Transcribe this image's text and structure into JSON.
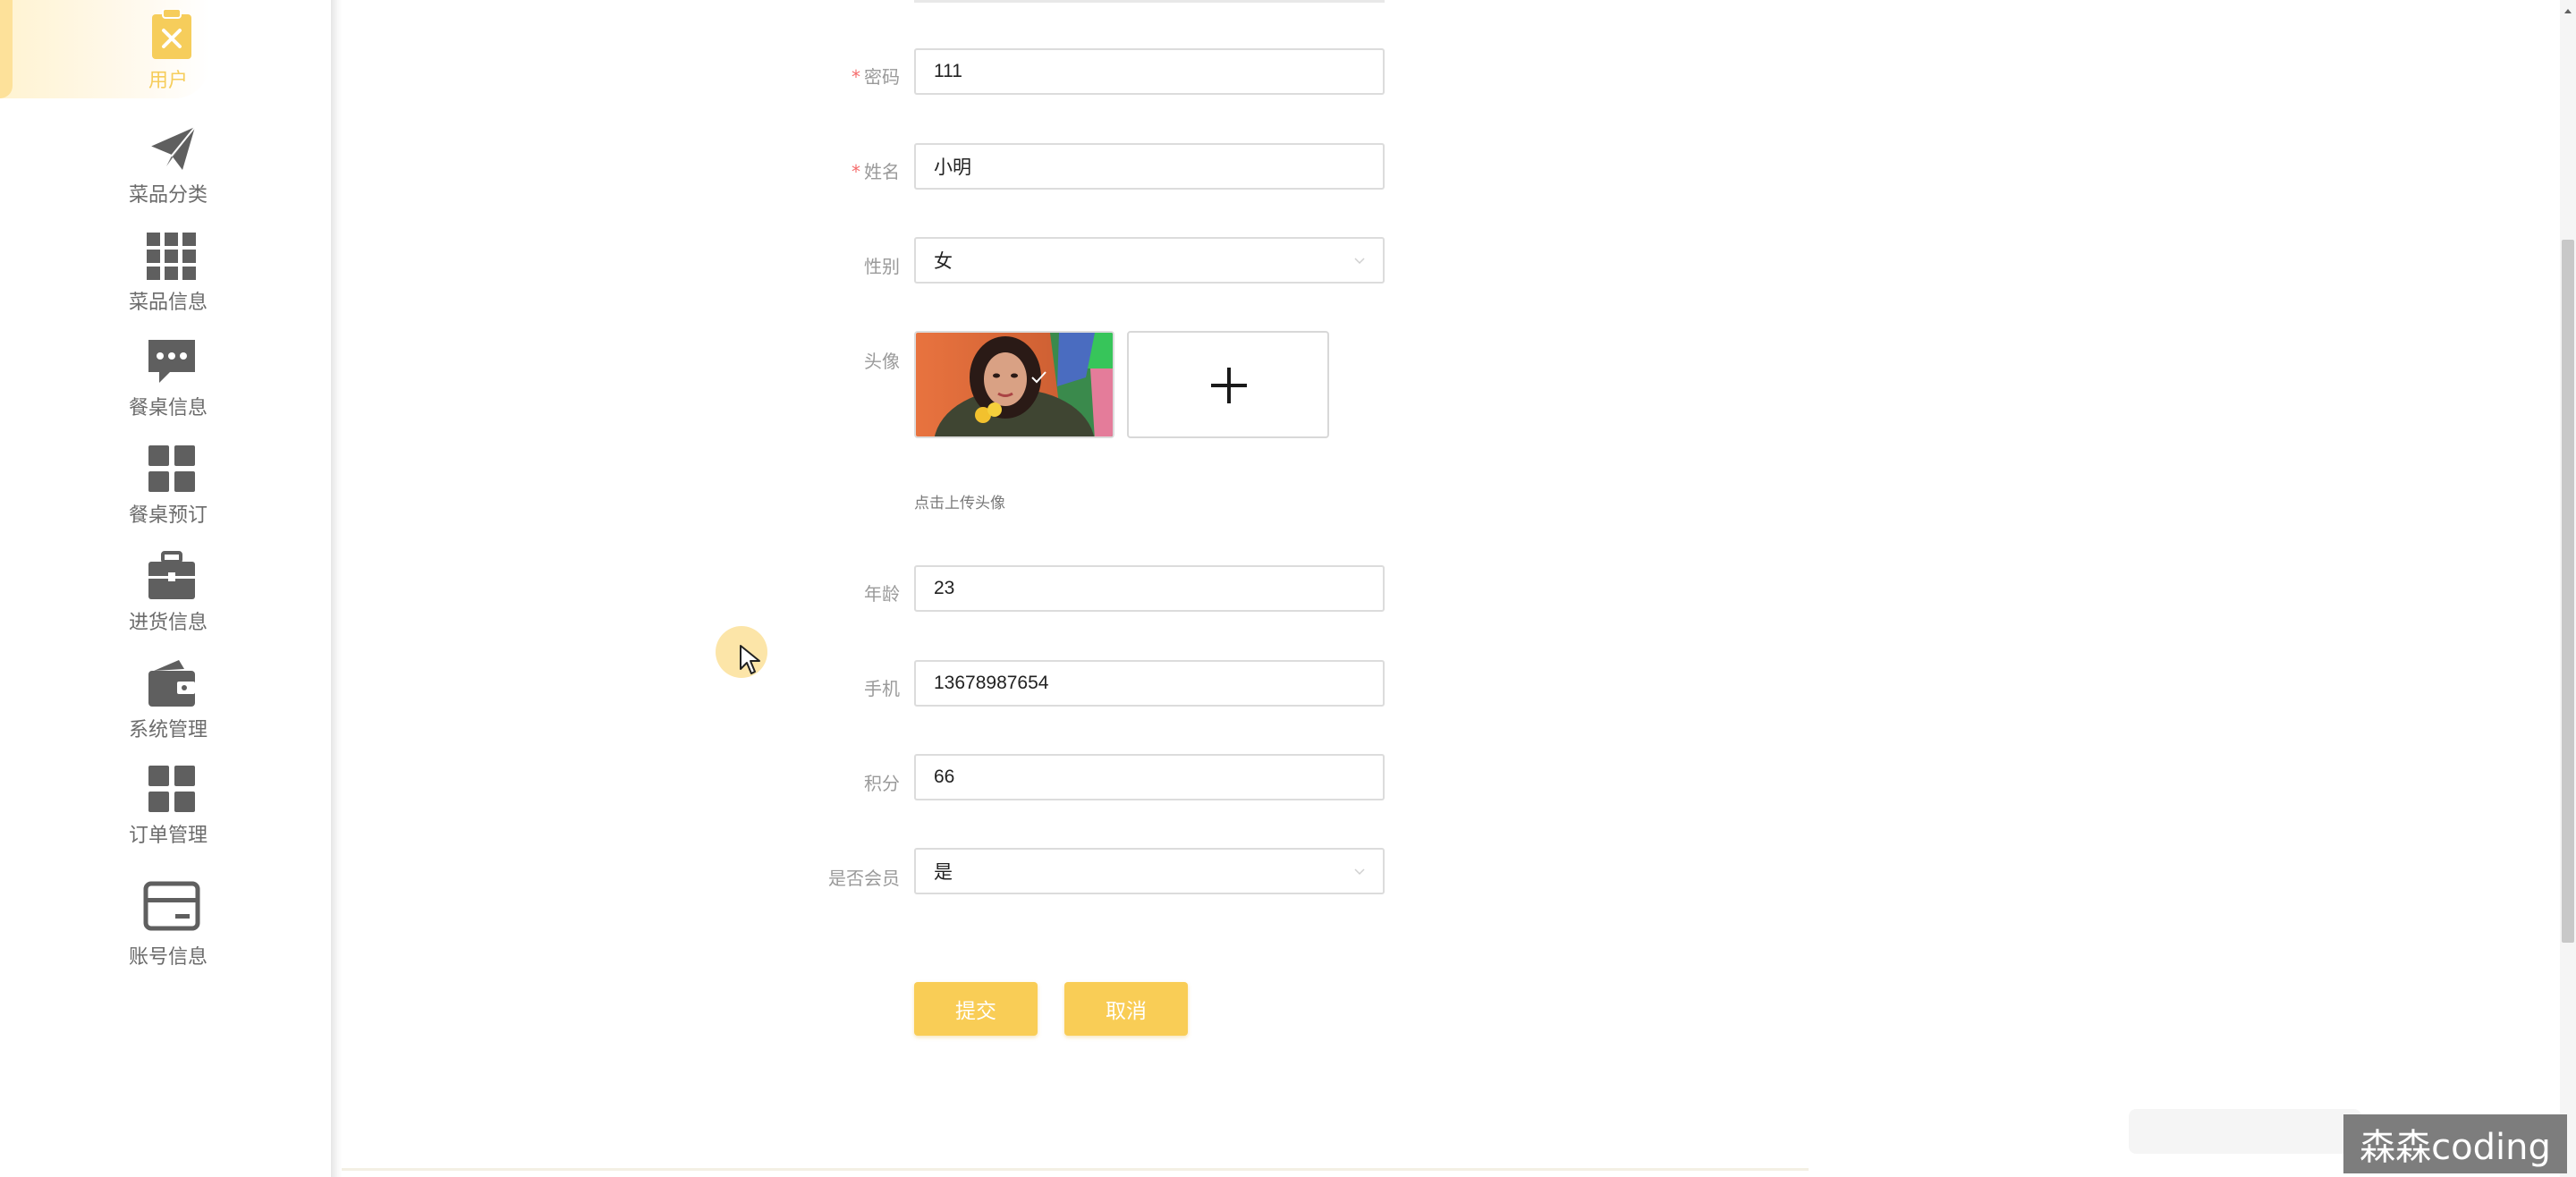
{
  "sidebar": {
    "items": [
      {
        "label": "用户",
        "icon": "clipboard-x-icon",
        "active": true
      },
      {
        "label": "菜品分类",
        "icon": "paper-plane-icon"
      },
      {
        "label": "菜品信息",
        "icon": "grid-icon"
      },
      {
        "label": "餐桌信息",
        "icon": "chat-bubble-icon"
      },
      {
        "label": "餐桌预订",
        "icon": "four-squares-icon"
      },
      {
        "label": "进货信息",
        "icon": "briefcase-icon"
      },
      {
        "label": "系统管理",
        "icon": "wallet-icon"
      },
      {
        "label": "订单管理",
        "icon": "four-squares-icon"
      },
      {
        "label": "账号信息",
        "icon": "card-icon"
      }
    ]
  },
  "form": {
    "password": {
      "label": "密码",
      "required": true,
      "value": "111"
    },
    "name": {
      "label": "姓名",
      "required": true,
      "value": "小明"
    },
    "gender": {
      "label": "性别",
      "value": "女"
    },
    "avatar": {
      "label": "头像",
      "hint": "点击上传头像"
    },
    "age": {
      "label": "年龄",
      "value": "23"
    },
    "phone": {
      "label": "手机",
      "value": "13678987654"
    },
    "points": {
      "label": "积分",
      "value": "66"
    },
    "is_member": {
      "label": "是否会员",
      "value": "是"
    },
    "required_mark": "*"
  },
  "actions": {
    "submit_label": "提交",
    "cancel_label": "取消"
  },
  "watermark": {
    "text": "森森coding"
  },
  "colors": {
    "accent": "#f9cd56",
    "active_text": "#f6cd5b",
    "icon": "#5f5f5f",
    "required": "#f56c6c"
  }
}
